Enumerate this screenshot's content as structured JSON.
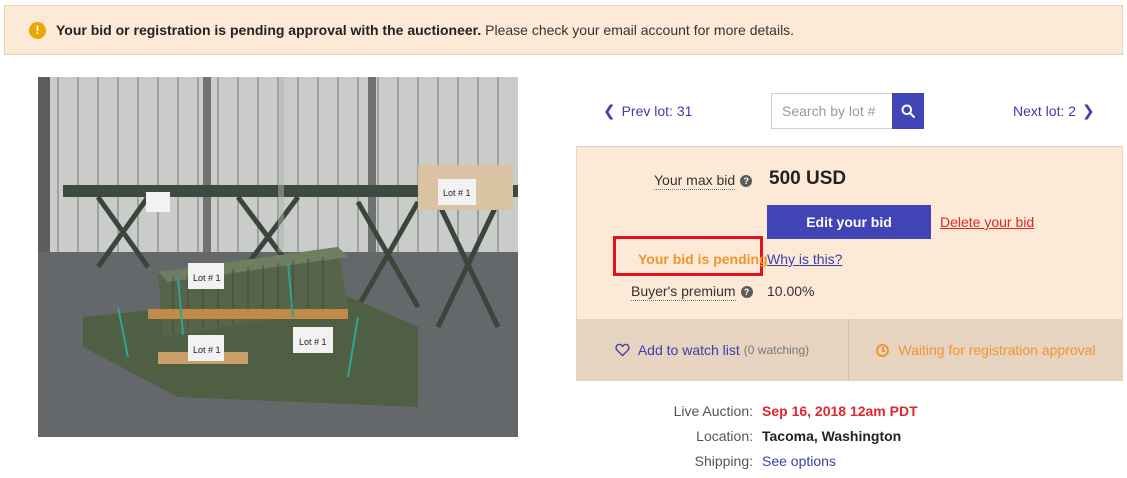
{
  "alert": {
    "bold": "Your bid or registration is pending approval with the auctioneer.",
    "text": " Please check your email account for more details.",
    "icon": "exclamation-circle-icon",
    "color": "#e9a700"
  },
  "photo": {
    "signs": [
      "Lot # 1",
      "Lot # 1",
      "Lot # 1",
      "Lot # 1"
    ]
  },
  "nav": {
    "prev_label": "Prev lot: 31",
    "next_label": "Next lot: 2",
    "search_placeholder": "Search by lot #"
  },
  "bid": {
    "max_bid_label": "Your max bid",
    "max_bid_value": "500 USD",
    "edit_label": "Edit your bid",
    "delete_label": "Delete your bid",
    "pending_label": "Your bid is pending",
    "why_label": "Why is this?",
    "premium_label": "Buyer's premium",
    "premium_value": "10.00%"
  },
  "actions": {
    "watch_label": "Add to watch list",
    "watch_count": "(0 watching)",
    "waiting_label": "Waiting for registration approval"
  },
  "info": {
    "auction_label": "Live Auction:",
    "auction_value": "Sep 16, 2018 12am PDT",
    "location_label": "Location:",
    "location_value": "Tacoma, Washington",
    "shipping_label": "Shipping:",
    "shipping_value": "See options"
  },
  "colors": {
    "primary": "#4044b5",
    "link": "#3b3fa8",
    "danger": "#e1262d",
    "pending": "#f0962f",
    "panel": "#fcead7"
  }
}
